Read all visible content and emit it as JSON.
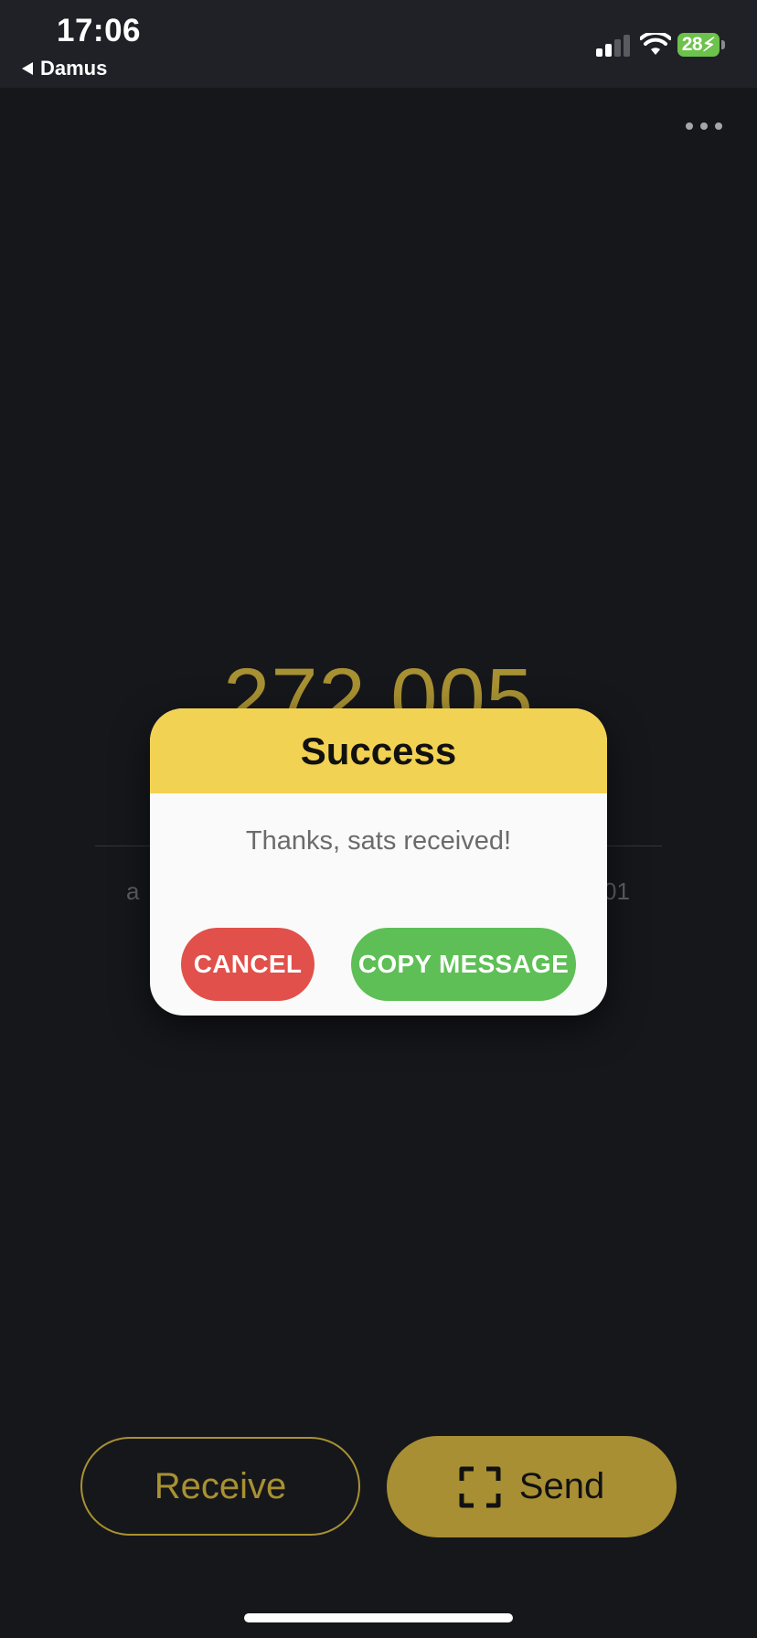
{
  "status_bar": {
    "time": "17:06",
    "back_app": "Damus",
    "battery": "28",
    "icons": [
      "signal-icon",
      "wifi-icon",
      "battery-charging-icon"
    ]
  },
  "header": {
    "menu_icon": "more-dots-icon"
  },
  "wallet": {
    "balance": "272,005",
    "subtitle_left": "a",
    "subtitle_right": "01"
  },
  "dialog": {
    "title": "Success",
    "message": "Thanks, sats received!",
    "cancel_label": "CANCEL",
    "copy_label": "COPY MESSAGE"
  },
  "actions": {
    "receive_label": "Receive",
    "send_label": "Send",
    "send_icon": "scan-icon"
  },
  "colors": {
    "background": "#16171b",
    "accent": "#a89132",
    "dialog_header": "#f2d252",
    "cancel": "#e1504a",
    "copy": "#5dbf55"
  }
}
